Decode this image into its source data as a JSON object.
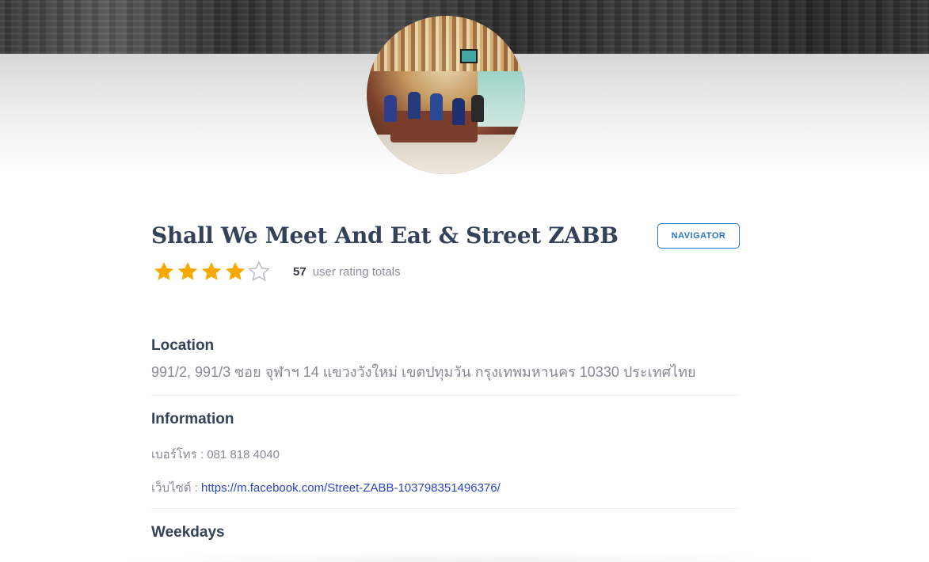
{
  "place": {
    "name": "Shall We Meet And Eat & Street ZABB",
    "navigator_label": "NAVIGATOR",
    "photo_icon": "restaurant-photo",
    "rating": {
      "stars_filled": 4,
      "stars_total": 5,
      "count": "57",
      "label": "user rating totals",
      "star_color": "#f7a900",
      "star_empty_color": "#b9bcc2"
    }
  },
  "location": {
    "title": "Location",
    "address": "991/2, 991/3 ซอย จุฬาฯ 14 แขวงวังใหม่ เขตปทุมวัน กรุงเทพมหานคร 10330 ประเทศไทย"
  },
  "information": {
    "title": "Information",
    "phone_label": "เบอร์โทร :",
    "phone_value": "081 818 4040",
    "website_label": "เว็บไซต์ :",
    "website_value": "https://m.facebook.com/Street-ZABB-103798351496376/",
    "link_color": "#2b44c9"
  },
  "weekdays": {
    "title": "Weekdays"
  },
  "colors": {
    "accent": "#2a73c6",
    "heading": "#334259",
    "muted": "#858a93"
  }
}
